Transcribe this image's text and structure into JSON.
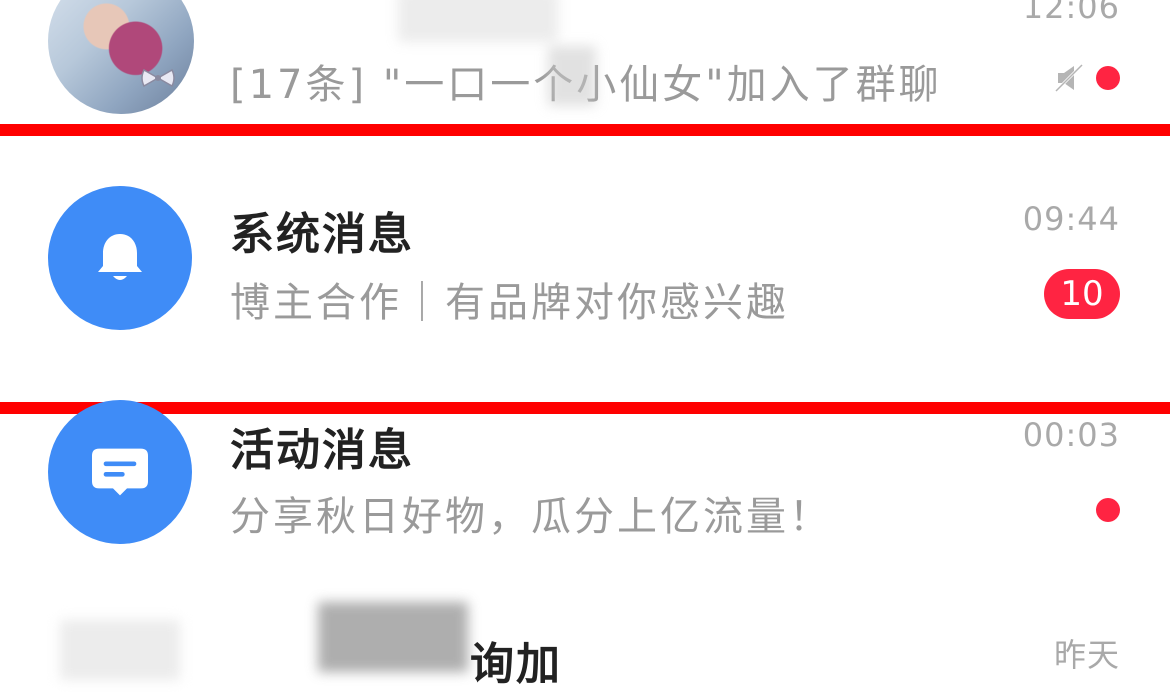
{
  "rows": [
    {
      "name": "group-chat",
      "time": "12:06",
      "preview": "[17条] \"一口一个小仙女\"加入了群聊"
    },
    {
      "name": "system-messages",
      "title": "系统消息",
      "time": "09:44",
      "preview": "博主合作｜有品牌对你感兴趣",
      "badge": "10",
      "icon": "bell-icon"
    },
    {
      "name": "activity-messages",
      "title": "活动消息",
      "time": "00:03",
      "preview": "分享秋日好物，瓜分上亿流量！",
      "icon": "message-icon"
    },
    {
      "name": "partial-chat",
      "title": "询加",
      "time": "昨天"
    }
  ],
  "colors": {
    "accent_red": "#ff2442",
    "avatar_blue": "#3f8cf7",
    "highlight_line": "#ff0000"
  }
}
